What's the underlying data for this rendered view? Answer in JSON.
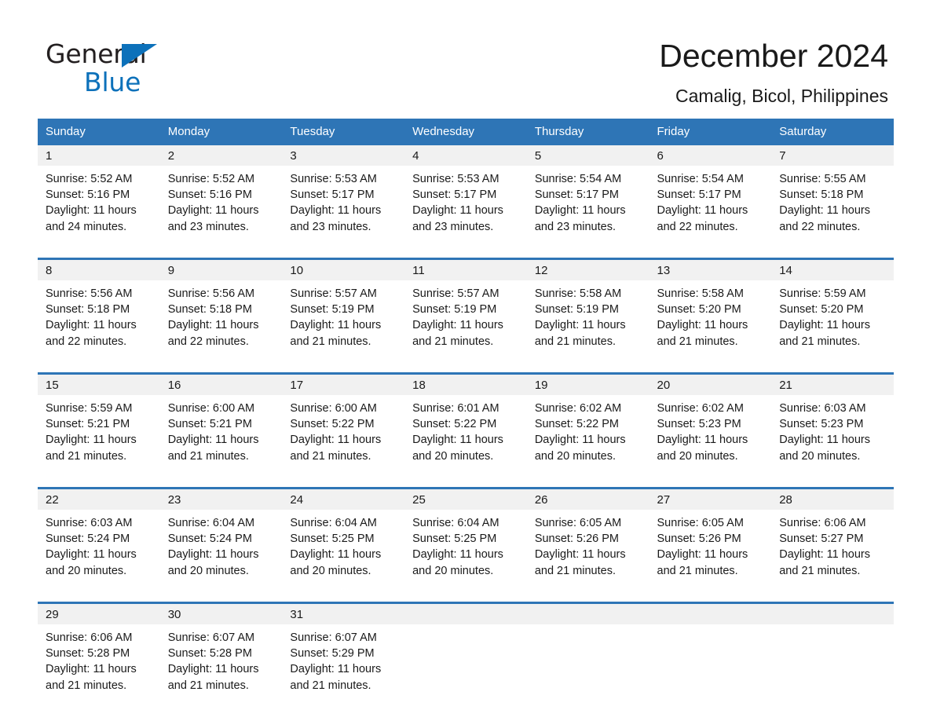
{
  "brand": {
    "logo_text_1": "General",
    "logo_text_2": "Blue",
    "logo_triangle_icon": "triangle-icon",
    "accent_blue": "#0d71ba",
    "header_blue": "#2e75b6",
    "daynum_gray": "#f1f1f1"
  },
  "header": {
    "month_title": "December 2024",
    "location": "Camalig, Bicol, Philippines"
  },
  "calendar": {
    "weekday_headers": [
      "Sunday",
      "Monday",
      "Tuesday",
      "Wednesday",
      "Thursday",
      "Friday",
      "Saturday"
    ],
    "weeks": [
      {
        "days": [
          {
            "num": "1",
            "sunrise": "Sunrise: 5:52 AM",
            "sunset": "Sunset: 5:16 PM",
            "daylight": "Daylight: 11 hours and 24 minutes."
          },
          {
            "num": "2",
            "sunrise": "Sunrise: 5:52 AM",
            "sunset": "Sunset: 5:16 PM",
            "daylight": "Daylight: 11 hours and 23 minutes."
          },
          {
            "num": "3",
            "sunrise": "Sunrise: 5:53 AM",
            "sunset": "Sunset: 5:17 PM",
            "daylight": "Daylight: 11 hours and 23 minutes."
          },
          {
            "num": "4",
            "sunrise": "Sunrise: 5:53 AM",
            "sunset": "Sunset: 5:17 PM",
            "daylight": "Daylight: 11 hours and 23 minutes."
          },
          {
            "num": "5",
            "sunrise": "Sunrise: 5:54 AM",
            "sunset": "Sunset: 5:17 PM",
            "daylight": "Daylight: 11 hours and 23 minutes."
          },
          {
            "num": "6",
            "sunrise": "Sunrise: 5:54 AM",
            "sunset": "Sunset: 5:17 PM",
            "daylight": "Daylight: 11 hours and 22 minutes."
          },
          {
            "num": "7",
            "sunrise": "Sunrise: 5:55 AM",
            "sunset": "Sunset: 5:18 PM",
            "daylight": "Daylight: 11 hours and 22 minutes."
          }
        ]
      },
      {
        "days": [
          {
            "num": "8",
            "sunrise": "Sunrise: 5:56 AM",
            "sunset": "Sunset: 5:18 PM",
            "daylight": "Daylight: 11 hours and 22 minutes."
          },
          {
            "num": "9",
            "sunrise": "Sunrise: 5:56 AM",
            "sunset": "Sunset: 5:18 PM",
            "daylight": "Daylight: 11 hours and 22 minutes."
          },
          {
            "num": "10",
            "sunrise": "Sunrise: 5:57 AM",
            "sunset": "Sunset: 5:19 PM",
            "daylight": "Daylight: 11 hours and 21 minutes."
          },
          {
            "num": "11",
            "sunrise": "Sunrise: 5:57 AM",
            "sunset": "Sunset: 5:19 PM",
            "daylight": "Daylight: 11 hours and 21 minutes."
          },
          {
            "num": "12",
            "sunrise": "Sunrise: 5:58 AM",
            "sunset": "Sunset: 5:19 PM",
            "daylight": "Daylight: 11 hours and 21 minutes."
          },
          {
            "num": "13",
            "sunrise": "Sunrise: 5:58 AM",
            "sunset": "Sunset: 5:20 PM",
            "daylight": "Daylight: 11 hours and 21 minutes."
          },
          {
            "num": "14",
            "sunrise": "Sunrise: 5:59 AM",
            "sunset": "Sunset: 5:20 PM",
            "daylight": "Daylight: 11 hours and 21 minutes."
          }
        ]
      },
      {
        "days": [
          {
            "num": "15",
            "sunrise": "Sunrise: 5:59 AM",
            "sunset": "Sunset: 5:21 PM",
            "daylight": "Daylight: 11 hours and 21 minutes."
          },
          {
            "num": "16",
            "sunrise": "Sunrise: 6:00 AM",
            "sunset": "Sunset: 5:21 PM",
            "daylight": "Daylight: 11 hours and 21 minutes."
          },
          {
            "num": "17",
            "sunrise": "Sunrise: 6:00 AM",
            "sunset": "Sunset: 5:22 PM",
            "daylight": "Daylight: 11 hours and 21 minutes."
          },
          {
            "num": "18",
            "sunrise": "Sunrise: 6:01 AM",
            "sunset": "Sunset: 5:22 PM",
            "daylight": "Daylight: 11 hours and 20 minutes."
          },
          {
            "num": "19",
            "sunrise": "Sunrise: 6:02 AM",
            "sunset": "Sunset: 5:22 PM",
            "daylight": "Daylight: 11 hours and 20 minutes."
          },
          {
            "num": "20",
            "sunrise": "Sunrise: 6:02 AM",
            "sunset": "Sunset: 5:23 PM",
            "daylight": "Daylight: 11 hours and 20 minutes."
          },
          {
            "num": "21",
            "sunrise": "Sunrise: 6:03 AM",
            "sunset": "Sunset: 5:23 PM",
            "daylight": "Daylight: 11 hours and 20 minutes."
          }
        ]
      },
      {
        "days": [
          {
            "num": "22",
            "sunrise": "Sunrise: 6:03 AM",
            "sunset": "Sunset: 5:24 PM",
            "daylight": "Daylight: 11 hours and 20 minutes."
          },
          {
            "num": "23",
            "sunrise": "Sunrise: 6:04 AM",
            "sunset": "Sunset: 5:24 PM",
            "daylight": "Daylight: 11 hours and 20 minutes."
          },
          {
            "num": "24",
            "sunrise": "Sunrise: 6:04 AM",
            "sunset": "Sunset: 5:25 PM",
            "daylight": "Daylight: 11 hours and 20 minutes."
          },
          {
            "num": "25",
            "sunrise": "Sunrise: 6:04 AM",
            "sunset": "Sunset: 5:25 PM",
            "daylight": "Daylight: 11 hours and 20 minutes."
          },
          {
            "num": "26",
            "sunrise": "Sunrise: 6:05 AM",
            "sunset": "Sunset: 5:26 PM",
            "daylight": "Daylight: 11 hours and 21 minutes."
          },
          {
            "num": "27",
            "sunrise": "Sunrise: 6:05 AM",
            "sunset": "Sunset: 5:26 PM",
            "daylight": "Daylight: 11 hours and 21 minutes."
          },
          {
            "num": "28",
            "sunrise": "Sunrise: 6:06 AM",
            "sunset": "Sunset: 5:27 PM",
            "daylight": "Daylight: 11 hours and 21 minutes."
          }
        ]
      },
      {
        "days": [
          {
            "num": "29",
            "sunrise": "Sunrise: 6:06 AM",
            "sunset": "Sunset: 5:28 PM",
            "daylight": "Daylight: 11 hours and 21 minutes."
          },
          {
            "num": "30",
            "sunrise": "Sunrise: 6:07 AM",
            "sunset": "Sunset: 5:28 PM",
            "daylight": "Daylight: 11 hours and 21 minutes."
          },
          {
            "num": "31",
            "sunrise": "Sunrise: 6:07 AM",
            "sunset": "Sunset: 5:29 PM",
            "daylight": "Daylight: 11 hours and 21 minutes."
          },
          {
            "num": "",
            "sunrise": "",
            "sunset": "",
            "daylight": ""
          },
          {
            "num": "",
            "sunrise": "",
            "sunset": "",
            "daylight": ""
          },
          {
            "num": "",
            "sunrise": "",
            "sunset": "",
            "daylight": ""
          },
          {
            "num": "",
            "sunrise": "",
            "sunset": "",
            "daylight": ""
          }
        ]
      }
    ]
  }
}
